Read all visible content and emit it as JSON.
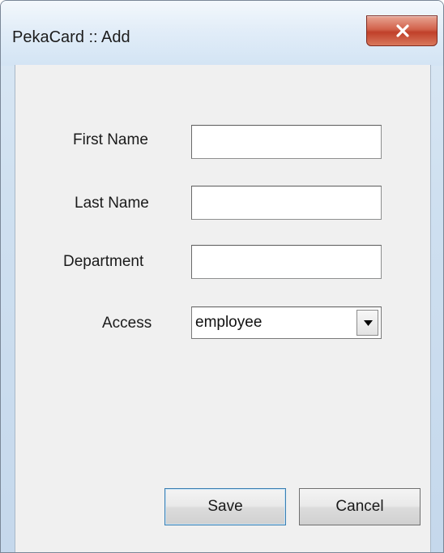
{
  "window": {
    "title": "PekaCard :: Add",
    "close_icon": "close-x-icon"
  },
  "form": {
    "first_name": {
      "label": "First Name",
      "value": ""
    },
    "last_name": {
      "label": "Last Name",
      "value": ""
    },
    "department": {
      "label": "Department",
      "value": ""
    },
    "access": {
      "label": "Access",
      "selected": "employee",
      "dropdown_icon": "chevron-down-icon"
    }
  },
  "buttons": {
    "save": "Save",
    "cancel": "Cancel"
  },
  "colors": {
    "close_button": "#c94a33",
    "client_background": "#f0f0f0",
    "frame": "#cfe0f0"
  }
}
